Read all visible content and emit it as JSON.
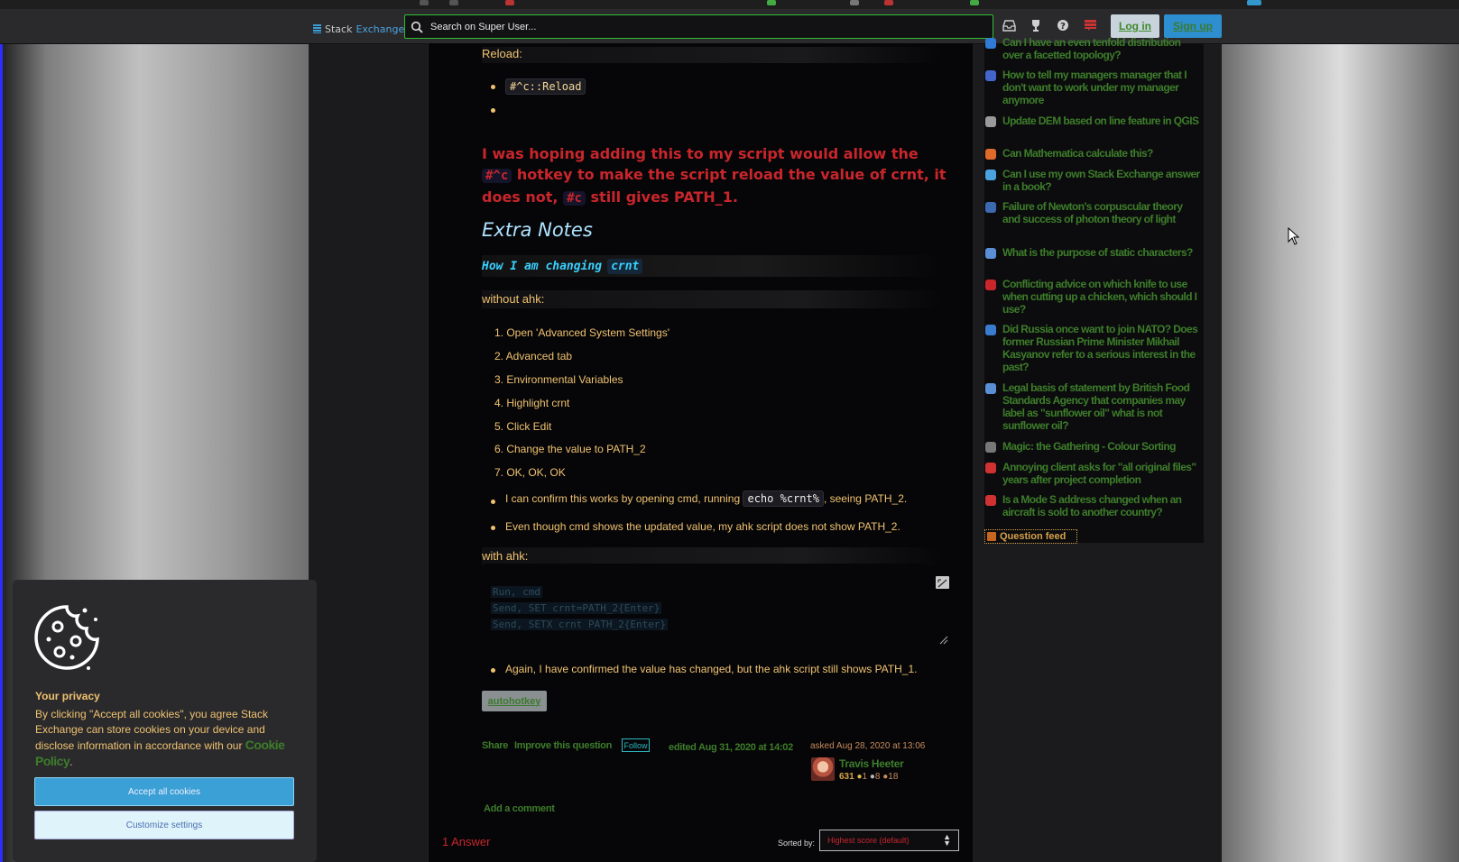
{
  "header": {
    "logo_left": "Stack",
    "logo_right": "Exchange",
    "search_placeholder": "Search on Super User...",
    "login": "Log in",
    "signup": "Sign up"
  },
  "post": {
    "reload_label": "Reload:",
    "reload_code": "#^c::Reload",
    "red_text_1": "I was hoping adding this to my script would allow the",
    "red_code_1": "#^c",
    "red_text_2": "hotkey to make the script reload the value of crnt, it does not,",
    "red_code_2": "#c",
    "red_text_3": "still gives PATH_1.",
    "extra_notes": "Extra Notes",
    "how_changing": "How I am changing",
    "how_changing_code": "crnt",
    "without_ahk": "without ahk:",
    "steps": [
      "1. Open 'Advanced System Settings'",
      "2. Advanced tab",
      "3. Environmental Variables",
      "4. Highlight crnt",
      "5. Click Edit",
      "6. Change the value to PATH_2",
      "7. OK, OK, OK"
    ],
    "confirm_pre": "I can confirm this works by opening cmd, running",
    "confirm_code": "echo %crnt%",
    "confirm_post": ", seeing PATH_2.",
    "even_though": "Even though cmd shows the updated value, my ahk script does not show PATH_2.",
    "with_ahk": "with ahk:",
    "code_lines": [
      "Run, cmd",
      "Send, SET crnt=PATH_2{Enter}",
      "Send, SETX crnt PATH_2{Enter}"
    ],
    "again": "Again, I have confirmed the value has changed, but the ahk script still shows PATH_1.",
    "tag": "autohotkey",
    "share": "Share",
    "improve": "Improve this question",
    "follow": "Follow",
    "edited": "edited Aug 31, 2020 at 14:02",
    "asked": "asked Aug 28, 2020 at 13:06",
    "user": "Travis Heeter",
    "rep": "631",
    "gold": "1",
    "silver": "8",
    "bronze": "18",
    "add_comment": "Add a comment",
    "answers_count": "1 Answer",
    "sorted_by": "Sorted by:",
    "sort_value": "Highest score (default)"
  },
  "sidebar": {
    "hot_questions": [
      {
        "title": "Can I have an even tenfold distribution over a facetted topology?",
        "color": "#2f7bd6"
      },
      {
        "title": "How to tell my managers manager that I don't want to work under my manager anymore",
        "color": "#4466cc"
      },
      {
        "title": "Update DEM based on line feature in QGIS",
        "color": "#9a9a9a"
      },
      {
        "title": "Can Mathematica calculate this?",
        "color": "#e06a2a"
      },
      {
        "title": "Can I use my own Stack Exchange answer in a book?",
        "color": "#4aa3df"
      },
      {
        "title": "Failure of Newton's corpuscular theory and success of photon theory of light",
        "color": "#3c6ab0"
      },
      {
        "title": "What is the purpose of static characters?",
        "color": "#5a8fd6"
      },
      {
        "title": "Conflicting advice on which knife to use when cutting up a chicken, which should I use?",
        "color": "#c9262c"
      },
      {
        "title": "Did Russia once want to join NATO? Does former Russian Prime Minister Mikhail Kasyanov refer to a serious interest in the past?",
        "color": "#3a7bd0"
      },
      {
        "title": "Legal basis of statement by British Food Standards Agency that companies may label as \"sunflower oil\" what is not sunflower oil?",
        "color": "#5a8fd6"
      },
      {
        "title": "Magic: the Gathering - Colour Sorting",
        "color": "#777777"
      },
      {
        "title": "Annoying client asks for \"all original files\" years after project completion",
        "color": "#d03232"
      },
      {
        "title": "Is a Mode S address changed when an aircraft is sold to another country?",
        "color": "#d03232"
      }
    ],
    "question_feed": "Question feed"
  },
  "cookie": {
    "title": "Your privacy",
    "body_pre": "By clicking \"Accept all cookies\", you agree Stack Exchange can store cookies on your device and disclose information in accordance with our",
    "policy_link": "Cookie Policy",
    "body_post": ".",
    "accept": "Accept all cookies",
    "customize": "Customize settings"
  }
}
